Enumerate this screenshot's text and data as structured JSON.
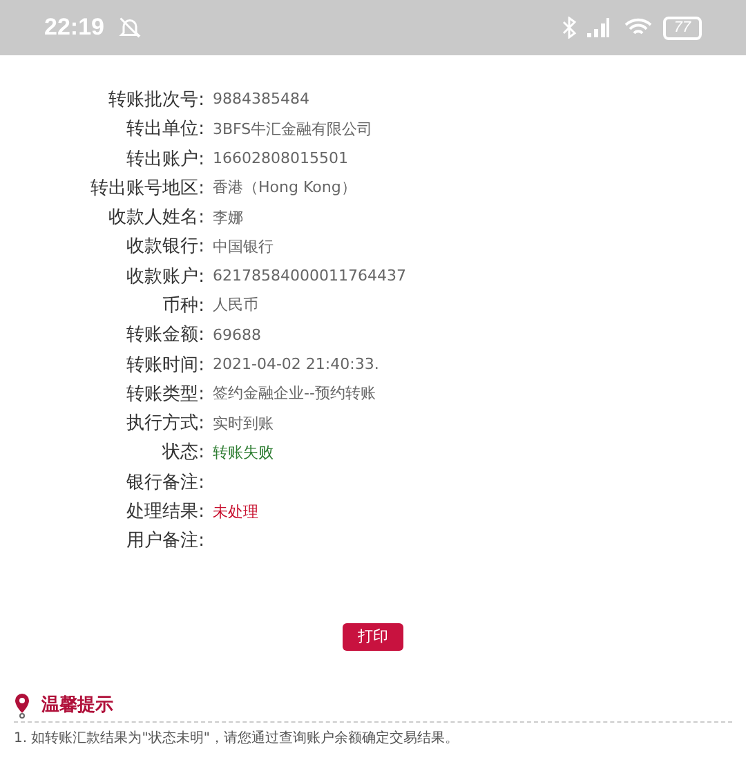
{
  "status_bar": {
    "time": "22:19",
    "battery": "77"
  },
  "details": [
    {
      "label": "转账批次号:",
      "value": "9884385484",
      "kind": "normal"
    },
    {
      "label": "转出单位:",
      "value": "3BFS牛汇金融有限公司",
      "kind": "normal"
    },
    {
      "label": "转出账户:",
      "value": "16602808015501",
      "kind": "normal"
    },
    {
      "label": "转出账号地区:",
      "value": "香港（Hong Kong）",
      "kind": "normal"
    },
    {
      "label": "收款人姓名:",
      "value": "李娜",
      "kind": "normal"
    },
    {
      "label": "收款银行:",
      "value": "中国银行",
      "kind": "normal"
    },
    {
      "label": "收款账户:",
      "value": "62178584000011764437",
      "kind": "normal"
    },
    {
      "label": "币种:",
      "value": "人民币",
      "kind": "normal"
    },
    {
      "label": "转账金额:",
      "value": "69688",
      "kind": "normal"
    },
    {
      "label": "转账时间:",
      "value": "2021-04-02 21:40:33.",
      "kind": "normal"
    },
    {
      "label": "转账类型:",
      "value": "签约金融企业--预约转账",
      "kind": "normal"
    },
    {
      "label": "执行方式:",
      "value": "实时到账",
      "kind": "normal"
    },
    {
      "label": "状态:",
      "value": "转账失败",
      "kind": "success"
    },
    {
      "label": "银行备注:"
    },
    {
      "label": "处理结果:",
      "value": "未处理",
      "kind": "error"
    },
    {
      "label": "用户备注:"
    }
  ],
  "print_button": "打印",
  "tips": {
    "title": "温馨提示",
    "items": [
      "1. 如转账汇款结果为\"状态未明\"，请您通过查询账户余额确定交易结果。"
    ]
  }
}
